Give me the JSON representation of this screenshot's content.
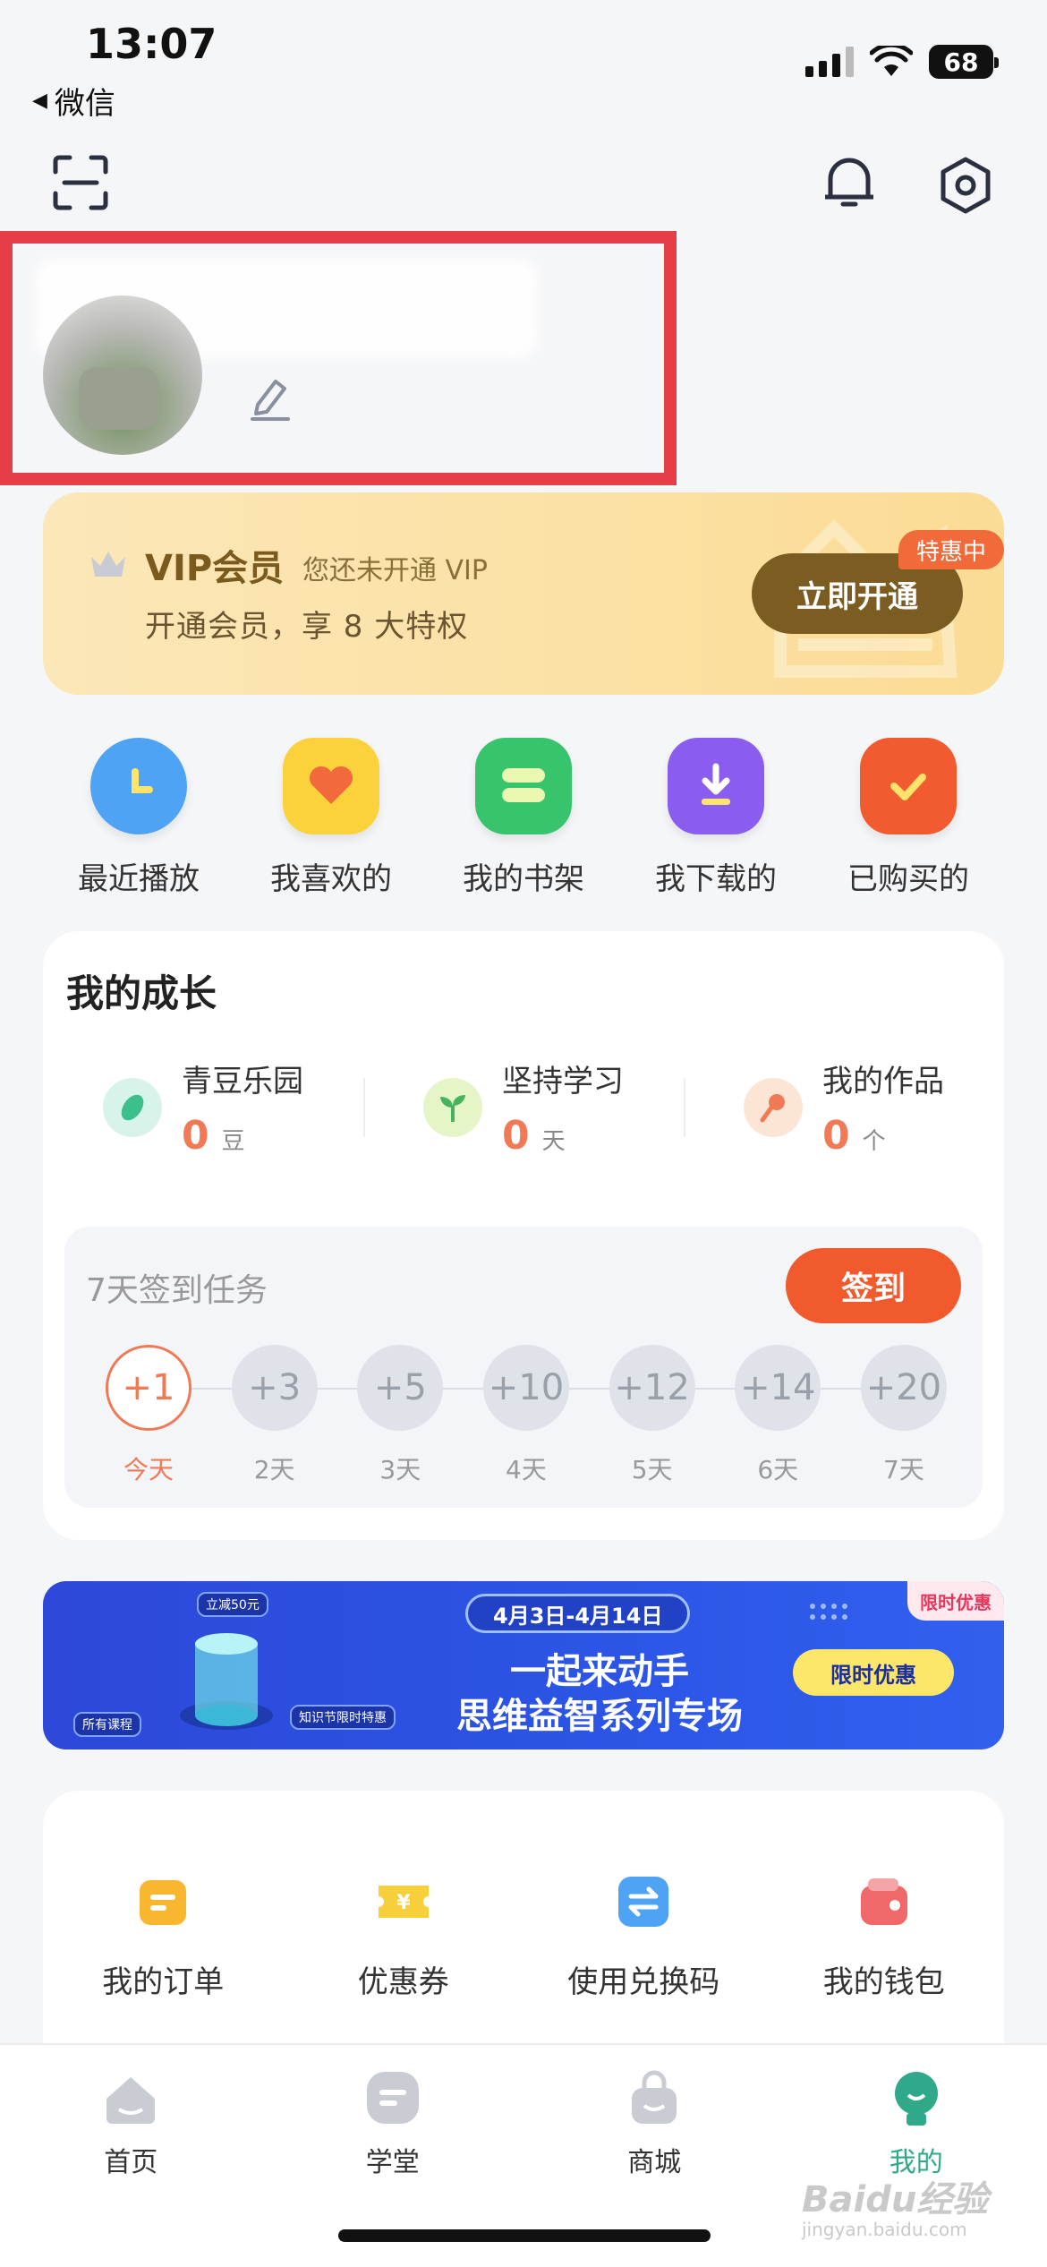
{
  "status_bar": {
    "time": "13:07",
    "back_label": "微信",
    "battery": "68"
  },
  "vip": {
    "title": "VIP会员",
    "subtitle": "您还未开通 VIP",
    "description": "开通会员，享 8 大特权",
    "button_label": "立即开通",
    "tag": "特惠中"
  },
  "quick_actions": [
    {
      "label": "最近播放",
      "icon": "clock-icon"
    },
    {
      "label": "我喜欢的",
      "icon": "heart-icon"
    },
    {
      "label": "我的书架",
      "icon": "bookshelf-icon"
    },
    {
      "label": "我下载的",
      "icon": "download-icon"
    },
    {
      "label": "已购买的",
      "icon": "purchased-icon"
    }
  ],
  "growth": {
    "title": "我的成长",
    "stats": [
      {
        "name": "青豆乐园",
        "value": "0",
        "unit": "豆",
        "icon": "bean-icon"
      },
      {
        "name": "坚持学习",
        "value": "0",
        "unit": "天",
        "icon": "sprout-icon"
      },
      {
        "name": "我的作品",
        "value": "0",
        "unit": "个",
        "icon": "microphone-icon"
      }
    ],
    "checkin": {
      "title": "7天签到任务",
      "button_label": "签到",
      "days": [
        {
          "points": "+1",
          "label": "今天"
        },
        {
          "points": "+3",
          "label": "2天"
        },
        {
          "points": "+5",
          "label": "3天"
        },
        {
          "points": "+10",
          "label": "4天"
        },
        {
          "points": "+12",
          "label": "5天"
        },
        {
          "points": "+14",
          "label": "6天"
        },
        {
          "points": "+20",
          "label": "7天"
        }
      ]
    }
  },
  "promo": {
    "date_range": "4月3日-4月14日",
    "line1": "一起来动手",
    "line2": "思维益智系列专场",
    "button_label": "限时优惠",
    "corner_tag": "限时优惠",
    "tag_discount": "立减50元",
    "tag_all_courses": "所有课程",
    "tag_festival": "知识节限时特惠"
  },
  "services": [
    {
      "label": "我的订单",
      "icon": "order-icon"
    },
    {
      "label": "优惠券",
      "icon": "coupon-icon"
    },
    {
      "label": "使用兑换码",
      "icon": "exchange-icon"
    },
    {
      "label": "我的钱包",
      "icon": "wallet-icon"
    }
  ],
  "tabbar": [
    {
      "label": "首页",
      "icon": "home-tab-icon"
    },
    {
      "label": "学堂",
      "icon": "school-tab-icon"
    },
    {
      "label": "商城",
      "icon": "shop-tab-icon"
    },
    {
      "label": "我的",
      "icon": "me-tab-icon",
      "active": true
    }
  ],
  "watermark": {
    "brand": "Baidu经验",
    "url": "jingyan.baidu.com"
  },
  "colors": {
    "accent": "#f05a2d",
    "vip_button": "#7b5d22",
    "tab_active": "#2fa98a",
    "highlight_box": "#e53e46"
  }
}
